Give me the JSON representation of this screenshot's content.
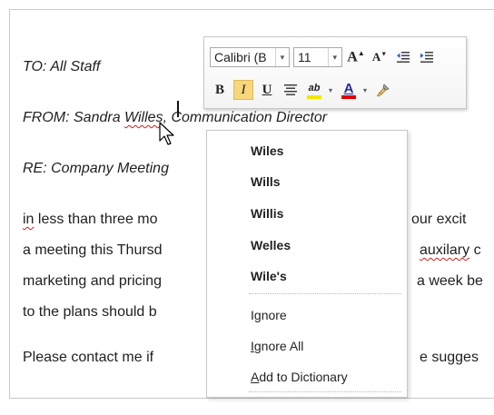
{
  "document": {
    "to_line": "TO: All Staff",
    "from_prefix": "FROM: Sandra ",
    "from_misspelled": "Willes",
    "from_suffix": ", Communication  Director",
    "re_line": "RE: Company  Meeting",
    "body_line1_misspelled": "in",
    "body_line1_a": " less than three mo",
    "body_line1_b": "our excit",
    "body_line2_a": "a meeting this Thursd",
    "body_line2_misspelled": "auxilary",
    "body_line2_b": " c",
    "body_line3_a": "marketing and pricing",
    "body_line3_b": "a week be",
    "body_line4_a": "to the plans should b",
    "body_line5_a": "Please contact me if",
    "body_line5_b": "e sugges"
  },
  "mini_toolbar": {
    "font_name": "Calibri (B",
    "font_size": "11",
    "grow_font_glyph": "A",
    "shrink_font_glyph": "A",
    "bold_label": "B",
    "italic_label": "I",
    "underline_label": "U",
    "font_color_glyph": "A",
    "highlight_glyph": "ab",
    "highlight_color": "#f5e600",
    "font_color": "#e00000",
    "active_button": "italic"
  },
  "context_menu": {
    "suggestions": [
      "Wiles",
      "Wills",
      "Willis",
      "Welles",
      "Wile's"
    ],
    "ignore_before": "I",
    "ignore_accel": "g",
    "ignore_after": "nore",
    "ignore_all_before": "",
    "ignore_all_accel": "I",
    "ignore_all_after": "gnore All",
    "add_dict_before": "",
    "add_dict_accel": "A",
    "add_dict_after": "dd to Dictionary"
  },
  "colors": {
    "squiggle": "#d11f1f",
    "active_button_bg": "#f8d67a"
  }
}
